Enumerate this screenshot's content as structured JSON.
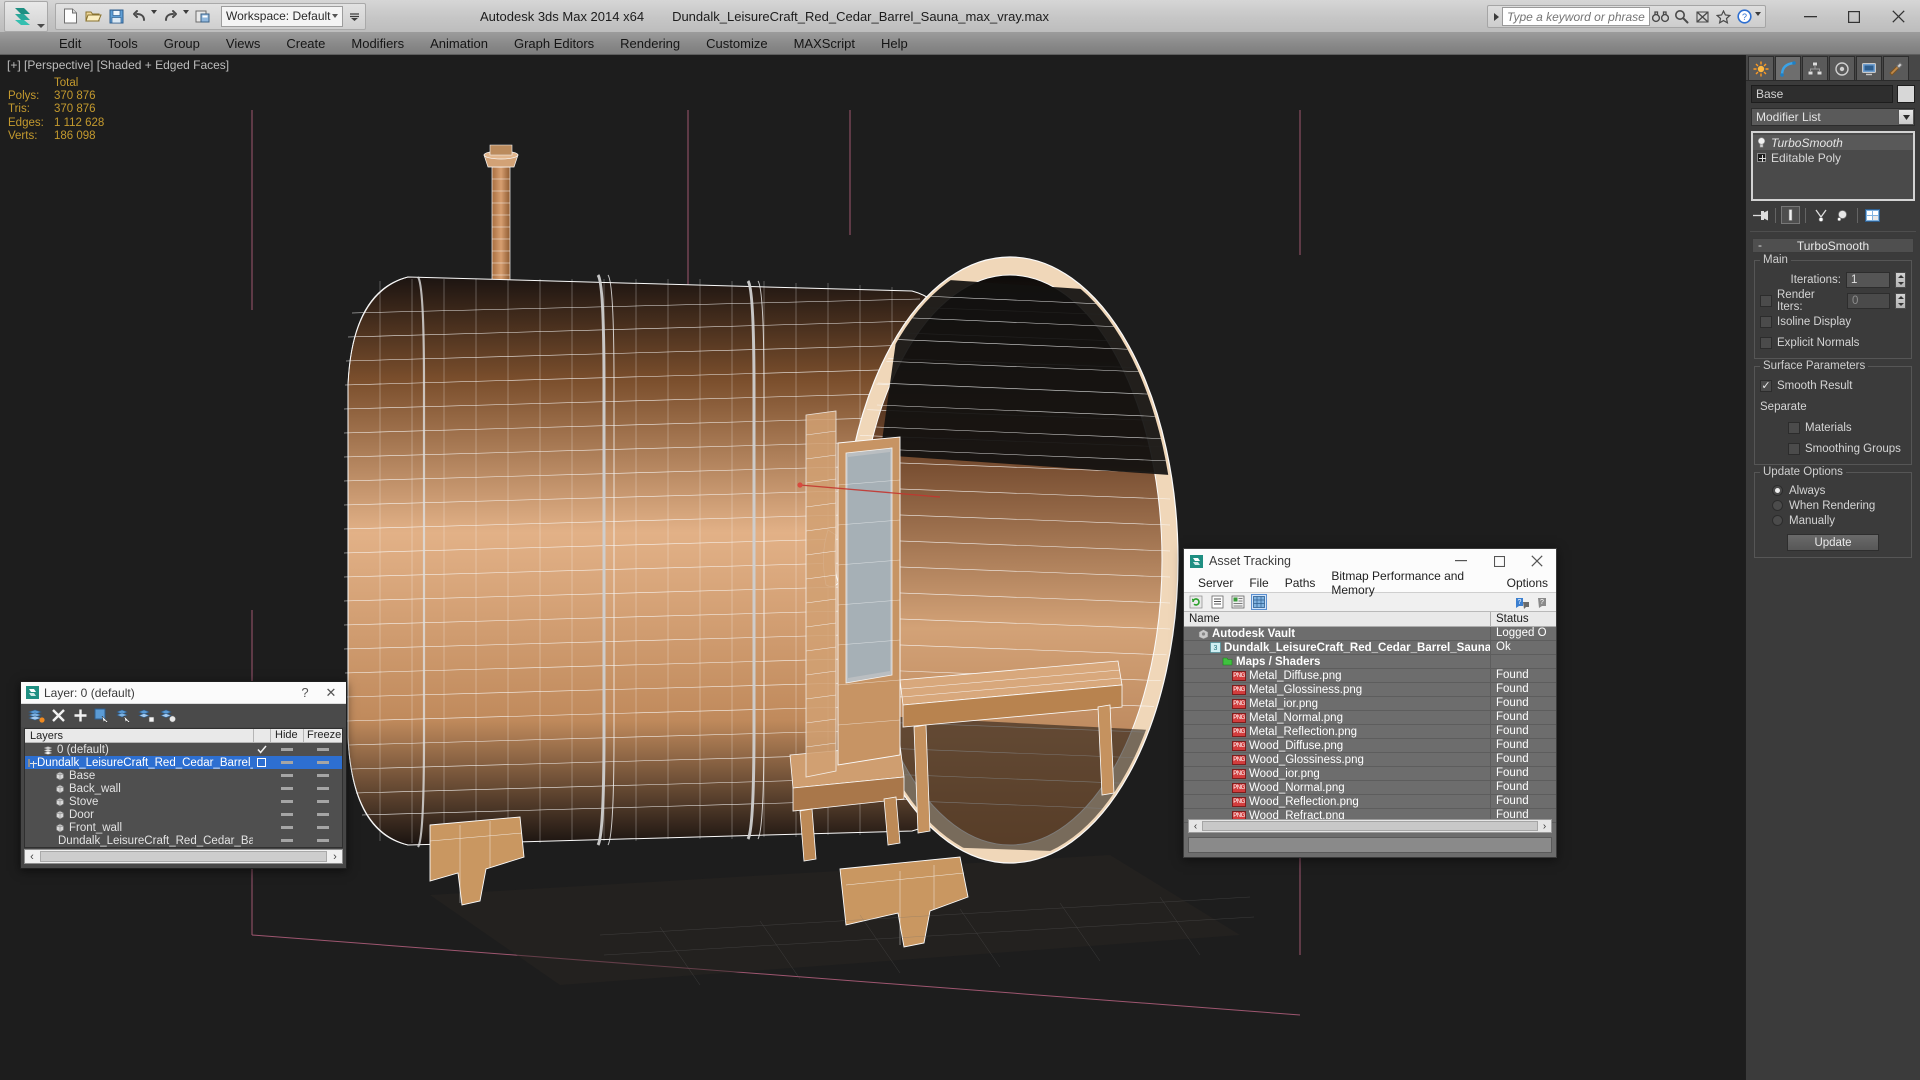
{
  "titlebar": {
    "app_title": "Autodesk 3ds Max  2014 x64",
    "file_title": "Dundalk_LeisureCraft_Red_Cedar_Barrel_Sauna_max_vray.max",
    "workspace": "Workspace: Default",
    "search_placeholder": "Type a keyword or phrase",
    "quick_access": [
      {
        "name": "new-file-icon",
        "label": "New"
      },
      {
        "name": "open-file-icon",
        "label": "Open"
      },
      {
        "name": "save-file-icon",
        "label": "Save"
      },
      {
        "name": "undo-icon",
        "label": "Undo"
      },
      {
        "name": "redo-icon",
        "label": "Redo"
      },
      {
        "name": "project-folder-icon",
        "label": "Set Project Folder"
      }
    ],
    "help_icons": [
      {
        "name": "search-binoculars-icon",
        "label": "Search"
      },
      {
        "name": "magnifier-icon",
        "label": "Find"
      },
      {
        "name": "subscription-icon",
        "label": "Subscription"
      },
      {
        "name": "favorites-star-icon",
        "label": "Favorites"
      },
      {
        "name": "help-question-icon",
        "label": "Help"
      }
    ],
    "window_controls": [
      {
        "name": "minimize-button",
        "glyph": "—"
      },
      {
        "name": "maximize-button",
        "glyph": "☐"
      },
      {
        "name": "close-button",
        "glyph": "✕"
      }
    ]
  },
  "menubar": {
    "items": [
      "Edit",
      "Tools",
      "Group",
      "Views",
      "Create",
      "Modifiers",
      "Animation",
      "Graph Editors",
      "Rendering",
      "Customize",
      "MAXScript",
      "Help"
    ]
  },
  "viewport": {
    "label": "[+] [Perspective] [Shaded + Edged Faces]",
    "stats_header": "Total",
    "stats": [
      {
        "label": "Polys:",
        "value": "370 876"
      },
      {
        "label": "Tris:",
        "value": "370 876"
      },
      {
        "label": "Edges:",
        "value": "1 112 628"
      },
      {
        "label": "Verts:",
        "value": "186 098"
      }
    ],
    "stats_color": "#c49a2e",
    "background_color": "#1d1d1d"
  },
  "command_panel": {
    "tabs": [
      {
        "name": "create-tab",
        "label": "Create"
      },
      {
        "name": "modify-tab",
        "label": "Modify",
        "active": true
      },
      {
        "name": "hierarchy-tab",
        "label": "Hierarchy"
      },
      {
        "name": "motion-tab",
        "label": "Motion"
      },
      {
        "name": "display-tab",
        "label": "Display"
      },
      {
        "name": "utilities-tab",
        "label": "Utilities"
      }
    ],
    "object_name": "Base",
    "modifier_list_label": "Modifier List",
    "stack": [
      {
        "label": "TurboSmooth",
        "italic": true,
        "selected": true
      },
      {
        "label": "Editable Poly",
        "italic": false,
        "selected": false
      }
    ],
    "rollout": {
      "title": "TurboSmooth",
      "main_group": "Main",
      "iterations_label": "Iterations:",
      "iterations_value": "1",
      "render_iters_label": "Render Iters:",
      "render_iters_value": "0",
      "render_iters_checked": false,
      "isoline_label": "Isoline Display",
      "isoline_checked": false,
      "explicit_normals_label": "Explicit Normals",
      "explicit_normals_checked": false,
      "surface_group": "Surface Parameters",
      "smooth_result_label": "Smooth Result",
      "smooth_result_checked": true,
      "separate_label": "Separate",
      "materials_label": "Materials",
      "materials_checked": false,
      "smoothing_groups_label": "Smoothing Groups",
      "smoothing_groups_checked": false,
      "update_group": "Update Options",
      "update_options": [
        {
          "label": "Always",
          "selected": true
        },
        {
          "label": "When Rendering",
          "selected": false
        },
        {
          "label": "Manually",
          "selected": false
        }
      ],
      "update_button": "Update"
    }
  },
  "layer_dialog": {
    "title": "Layer: 0 (default)",
    "help_glyph": "?",
    "close_glyph": "✕",
    "toolbar": [
      {
        "name": "new-layer-icon",
        "label": "Create New Layer"
      },
      {
        "name": "delete-layer-icon",
        "label": "Delete Highlighted Empty Layers"
      },
      {
        "name": "add-layer-icon",
        "label": "Add Selected Objects to Highlighted Layer"
      },
      {
        "name": "select-objects-in-layer-icon",
        "label": "Select Objects in Highlighted Layers"
      },
      {
        "name": "highlight-selected-objects-layer-icon",
        "label": "Highlight Selected Objects Layers"
      },
      {
        "name": "set-current-layer-icon",
        "label": "Set Highlighted Layer to Current"
      },
      {
        "name": "layer-properties-icon",
        "label": "Layer Properties"
      }
    ],
    "columns": [
      "Layers",
      "",
      "Hide",
      "Freeze"
    ],
    "rows": [
      {
        "name": "0 (default)",
        "indent": 1,
        "current": true,
        "selected": false,
        "expandable": false
      },
      {
        "name": "Dundalk_LeisureCraft_Red_Cedar_Barrel_Sauna",
        "indent": 0,
        "current": false,
        "selected": true,
        "expandable": true
      },
      {
        "name": "Base",
        "indent": 2,
        "current": false,
        "selected": false,
        "expandable": false,
        "object": true
      },
      {
        "name": "Back_wall",
        "indent": 2,
        "current": false,
        "selected": false,
        "expandable": false,
        "object": true
      },
      {
        "name": "Stove",
        "indent": 2,
        "current": false,
        "selected": false,
        "expandable": false,
        "object": true
      },
      {
        "name": "Door",
        "indent": 2,
        "current": false,
        "selected": false,
        "expandable": false,
        "object": true
      },
      {
        "name": "Front_wall",
        "indent": 2,
        "current": false,
        "selected": false,
        "expandable": false,
        "object": true
      },
      {
        "name": "Dundalk_LeisureCraft_Red_Cedar_Barrel_Sauna",
        "indent": 2,
        "current": false,
        "selected": false,
        "expandable": false,
        "object": true
      }
    ]
  },
  "asset_tracking": {
    "title": "Asset Tracking",
    "window_controls": [
      {
        "name": "minimize-button",
        "glyph": "—"
      },
      {
        "name": "maximize-button",
        "glyph": "☐"
      },
      {
        "name": "close-button",
        "glyph": "✕"
      }
    ],
    "menu": [
      "Server",
      "File",
      "Paths",
      "Bitmap Performance and Memory",
      "Options"
    ],
    "toolbar": [
      {
        "name": "refresh-icon",
        "label": "Refresh"
      },
      {
        "name": "list-view-icon",
        "label": "List View"
      },
      {
        "name": "detail-view-icon",
        "label": "Detail View"
      },
      {
        "name": "grid-view-icon",
        "label": "Grid View",
        "active": true
      }
    ],
    "help_icons": [
      {
        "name": "help-icon",
        "label": "Help"
      },
      {
        "name": "about-icon",
        "label": "About"
      }
    ],
    "columns": [
      "Name",
      "Status"
    ],
    "rows": [
      {
        "name": "Autodesk Vault",
        "status": "Logged O",
        "indent": 0,
        "icon": "vault-icon"
      },
      {
        "name": "Dundalk_LeisureCraft_Red_Cedar_Barrel_Sauna_max_vray.max",
        "status": "Ok",
        "indent": 1,
        "icon": "max-file-icon"
      },
      {
        "name": "Maps / Shaders",
        "status": "",
        "indent": 2,
        "icon": "maps-folder-icon"
      },
      {
        "name": "Metal_Diffuse.png",
        "status": "Found",
        "indent": 3,
        "icon": "png-icon"
      },
      {
        "name": "Metal_Glossiness.png",
        "status": "Found",
        "indent": 3,
        "icon": "png-icon"
      },
      {
        "name": "Metal_ior.png",
        "status": "Found",
        "indent": 3,
        "icon": "png-icon"
      },
      {
        "name": "Metal_Normal.png",
        "status": "Found",
        "indent": 3,
        "icon": "png-icon"
      },
      {
        "name": "Metal_Reflection.png",
        "status": "Found",
        "indent": 3,
        "icon": "png-icon"
      },
      {
        "name": "Wood_Diffuse.png",
        "status": "Found",
        "indent": 3,
        "icon": "png-icon"
      },
      {
        "name": "Wood_Glossiness.png",
        "status": "Found",
        "indent": 3,
        "icon": "png-icon"
      },
      {
        "name": "Wood_ior.png",
        "status": "Found",
        "indent": 3,
        "icon": "png-icon"
      },
      {
        "name": "Wood_Normal.png",
        "status": "Found",
        "indent": 3,
        "icon": "png-icon"
      },
      {
        "name": "Wood_Reflection.png",
        "status": "Found",
        "indent": 3,
        "icon": "png-icon"
      },
      {
        "name": "Wood_Refract.png",
        "status": "Found",
        "indent": 3,
        "icon": "png-icon"
      }
    ]
  },
  "colors": {
    "accent_blue": "#2d6fd1",
    "stats_gold": "#c49a2e",
    "wood_light": "#e3b486",
    "wood_mid": "#c98f5c",
    "wood_dark": "#8a5a33",
    "wireframe": "#f2f2f2",
    "grid_magenta": "#b5607f"
  }
}
